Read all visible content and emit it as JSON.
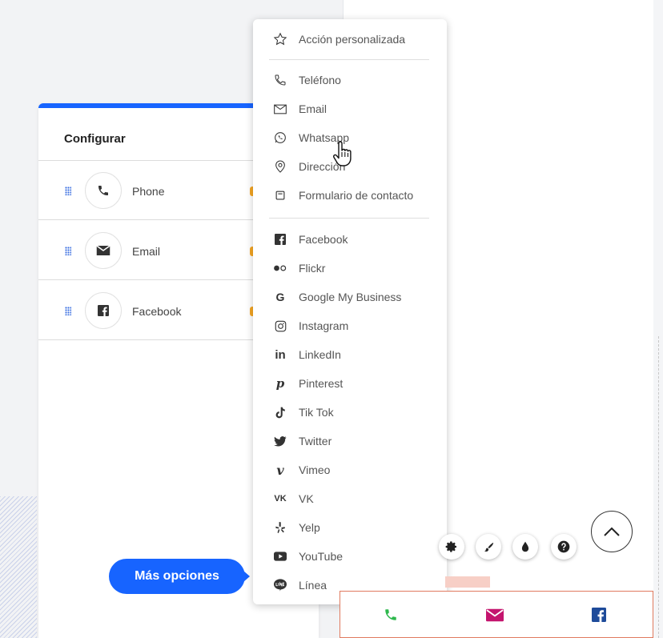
{
  "config": {
    "title": "Configurar",
    "rows": [
      {
        "label": "Phone",
        "icon": "phone-icon"
      },
      {
        "label": "Email",
        "icon": "envelope-icon"
      },
      {
        "label": "Facebook",
        "icon": "facebook-icon"
      }
    ],
    "more_options_label": "Más opciones"
  },
  "menu": {
    "custom_action": "Acción personalizada",
    "contact_items": [
      "Teléfono",
      "Email",
      "Whatsapp",
      "Dirección",
      "Formulario de contacto"
    ],
    "social_items": [
      "Facebook",
      "Flickr",
      "Google My Business",
      "Instagram",
      "LinkedIn",
      "Pinterest",
      "Tik Tok",
      "Twitter",
      "Vimeo",
      "VK",
      "Yelp",
      "YouTube",
      "Línea"
    ]
  },
  "colors": {
    "accent": "#1764ff",
    "phone_green": "#2eb84d",
    "email_magenta": "#c4146e",
    "facebook_blue": "#1e4b9a",
    "widget_border": "#e07a5f"
  }
}
